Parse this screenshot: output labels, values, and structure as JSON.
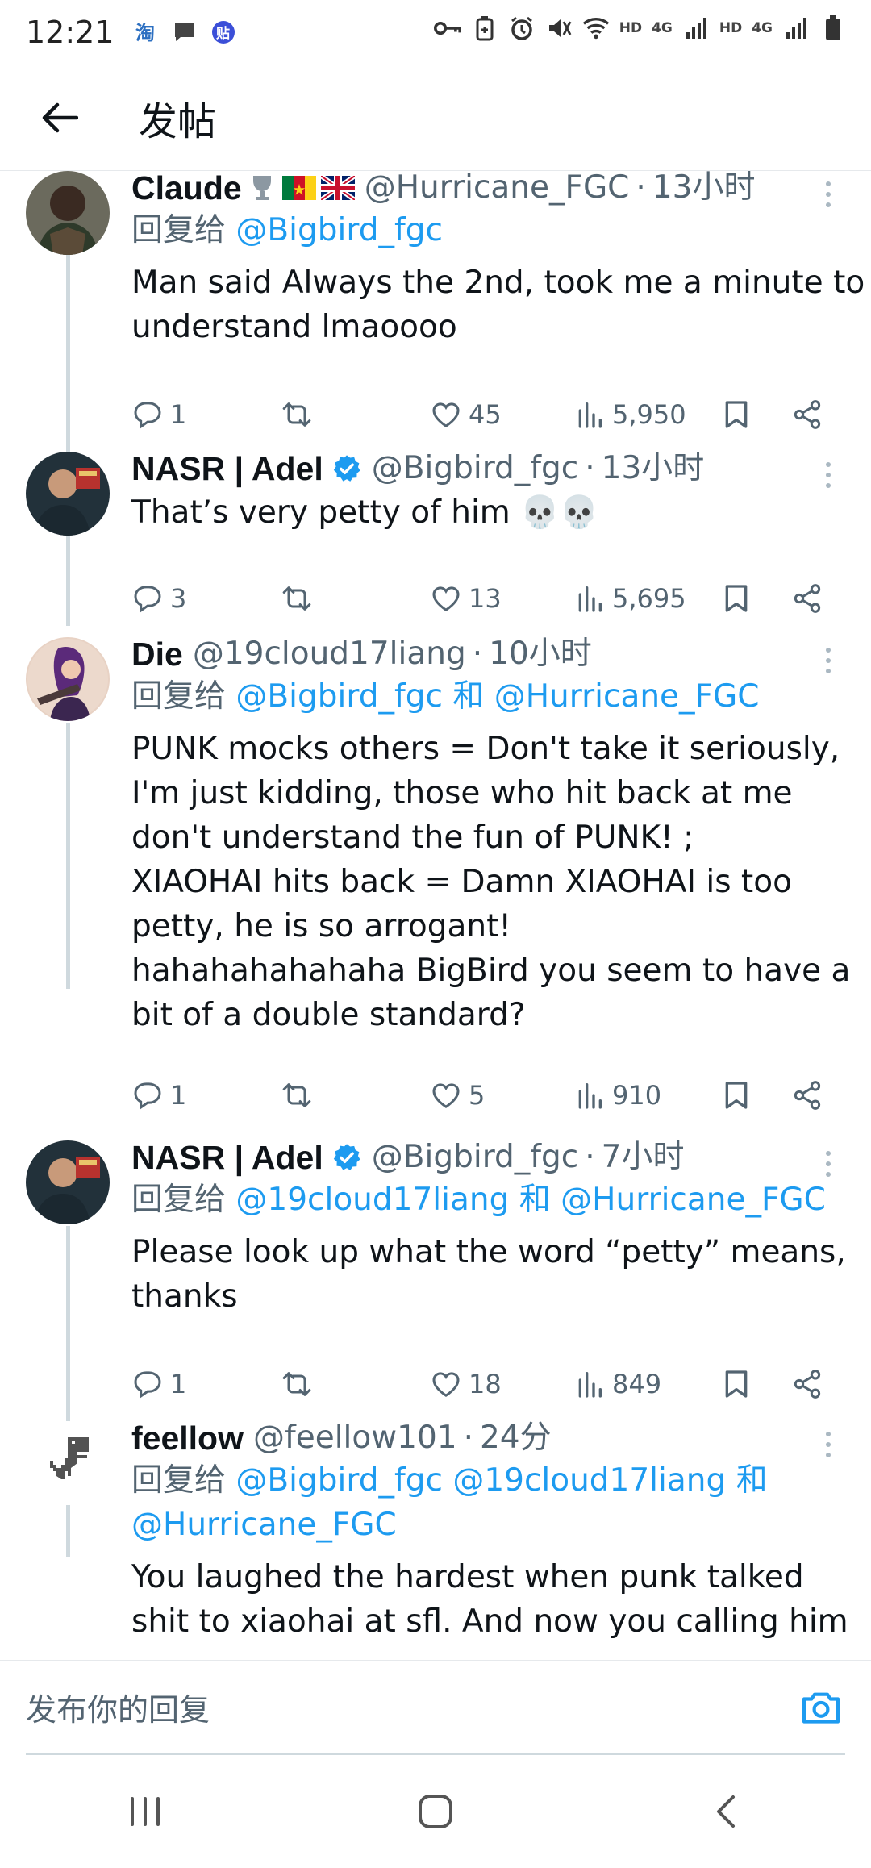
{
  "status_bar": {
    "time": "12:21",
    "left_icons": [
      "taobao-icon",
      "message-icon",
      "tieba-icon"
    ],
    "right_icons": [
      "key-icon",
      "battery-saver-icon",
      "alarm-icon",
      "mute-icon",
      "wifi-icon",
      "signal-icon",
      "battery-icon"
    ],
    "network_labels": [
      "HD",
      "4G",
      "HD",
      "4G"
    ]
  },
  "header": {
    "title": "发帖",
    "back_icon": "arrow-left-icon"
  },
  "tweets": [
    {
      "name": "Claude",
      "handle": "@Hurricane_FGC",
      "time": "13小时",
      "verified": false,
      "reply_prefix": "回复给",
      "reply_to": [
        "@Bigbird_fgc"
      ],
      "text_lines": [
        "Man said Always the 2nd, took me a minute to",
        "understand lmaoooo"
      ],
      "replies": "1",
      "retweets": "",
      "likes": "45",
      "views": "5,950"
    },
    {
      "name": "NASR | Adel",
      "handle": "@Bigbird_fgc",
      "time": "13小时",
      "verified": true,
      "text_lines": [
        "That’s very petty of him 💀💀"
      ],
      "replies": "3",
      "retweets": "",
      "likes": "13",
      "views": "5,695"
    },
    {
      "name": "Die",
      "handle": "@19cloud17liang",
      "time": "10小时",
      "verified": false,
      "reply_prefix": "回复给",
      "reply_to": [
        "@Bigbird_fgc",
        "和",
        "@Hurricane_FGC"
      ],
      "text_lines": [
        "PUNK mocks others = Don't take it seriously,",
        "I'm just kidding, those who hit back at me",
        "don't understand the fun of PUNK! ;",
        "XIAOHAI hits back = Damn XIAOHAI is too",
        "petty, he is so arrogant!",
        "hahahahahahaha BigBird you seem to have a",
        "bit of a double standard?"
      ],
      "replies": "1",
      "retweets": "",
      "likes": "5",
      "views": "910"
    },
    {
      "name": "NASR | Adel",
      "handle": "@Bigbird_fgc",
      "time": "7小时",
      "verified": true,
      "reply_prefix": "回复给",
      "reply_to": [
        "@19cloud17liang",
        "和",
        "@Hurricane_FGC"
      ],
      "text_lines": [
        "Please look up what the word “petty” means,",
        "thanks"
      ],
      "replies": "1",
      "retweets": "",
      "likes": "18",
      "views": "849"
    },
    {
      "name": "feellow",
      "handle": "@feellow101",
      "time": "24分",
      "verified": false,
      "reply_prefix": "回复给",
      "reply_to_line1": [
        "@Bigbird_fgc",
        "@19cloud17liang",
        "和"
      ],
      "reply_to_line2": [
        "@Hurricane_FGC"
      ],
      "text_lines": [
        "You laughed the hardest when punk talked",
        "shit to xiaohai at sfl. And now you calling him"
      ]
    }
  ],
  "compose": {
    "placeholder": "发布你的回复",
    "camera_icon": "camera-icon"
  },
  "navbar": {
    "buttons": [
      "recent-apps-icon",
      "home-icon",
      "back-icon"
    ]
  },
  "colors": {
    "accent": "#1d9bf0",
    "muted": "#536471",
    "text": "#0f1419",
    "thread_line": "#cfd9de"
  }
}
